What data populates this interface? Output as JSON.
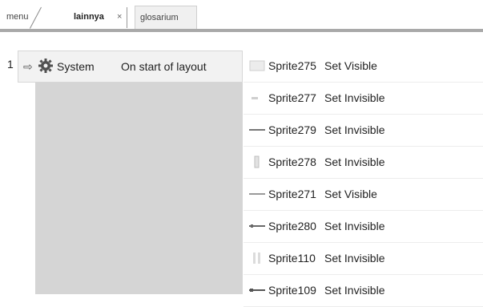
{
  "tabs": [
    {
      "label": "menu"
    },
    {
      "label": "lainnya",
      "close": "×"
    },
    {
      "label": "glosarium"
    }
  ],
  "event": {
    "number": "1",
    "condition": {
      "object": "System",
      "text": "On start of layout"
    },
    "actions": [
      {
        "object": "Sprite275",
        "action": "Set Visible"
      },
      {
        "object": "Sprite277",
        "action": "Set Invisible"
      },
      {
        "object": "Sprite279",
        "action": "Set Invisible"
      },
      {
        "object": "Sprite278",
        "action": "Set Invisible"
      },
      {
        "object": "Sprite271",
        "action": "Set Visible"
      },
      {
        "object": "Sprite280",
        "action": "Set Invisible"
      },
      {
        "object": "Sprite110",
        "action": "Set Invisible"
      },
      {
        "object": "Sprite109",
        "action": "Set Invisible"
      }
    ]
  },
  "icons": {
    "condition_arrow": "arrow-right-icon",
    "system": "gear-icon",
    "sprites": [
      "sprite-icon"
    ]
  },
  "colors": {
    "tab_underline": "#a9a9a9",
    "condition_panel": "#d5d5d5",
    "condition_row": "#f2f2f2"
  }
}
